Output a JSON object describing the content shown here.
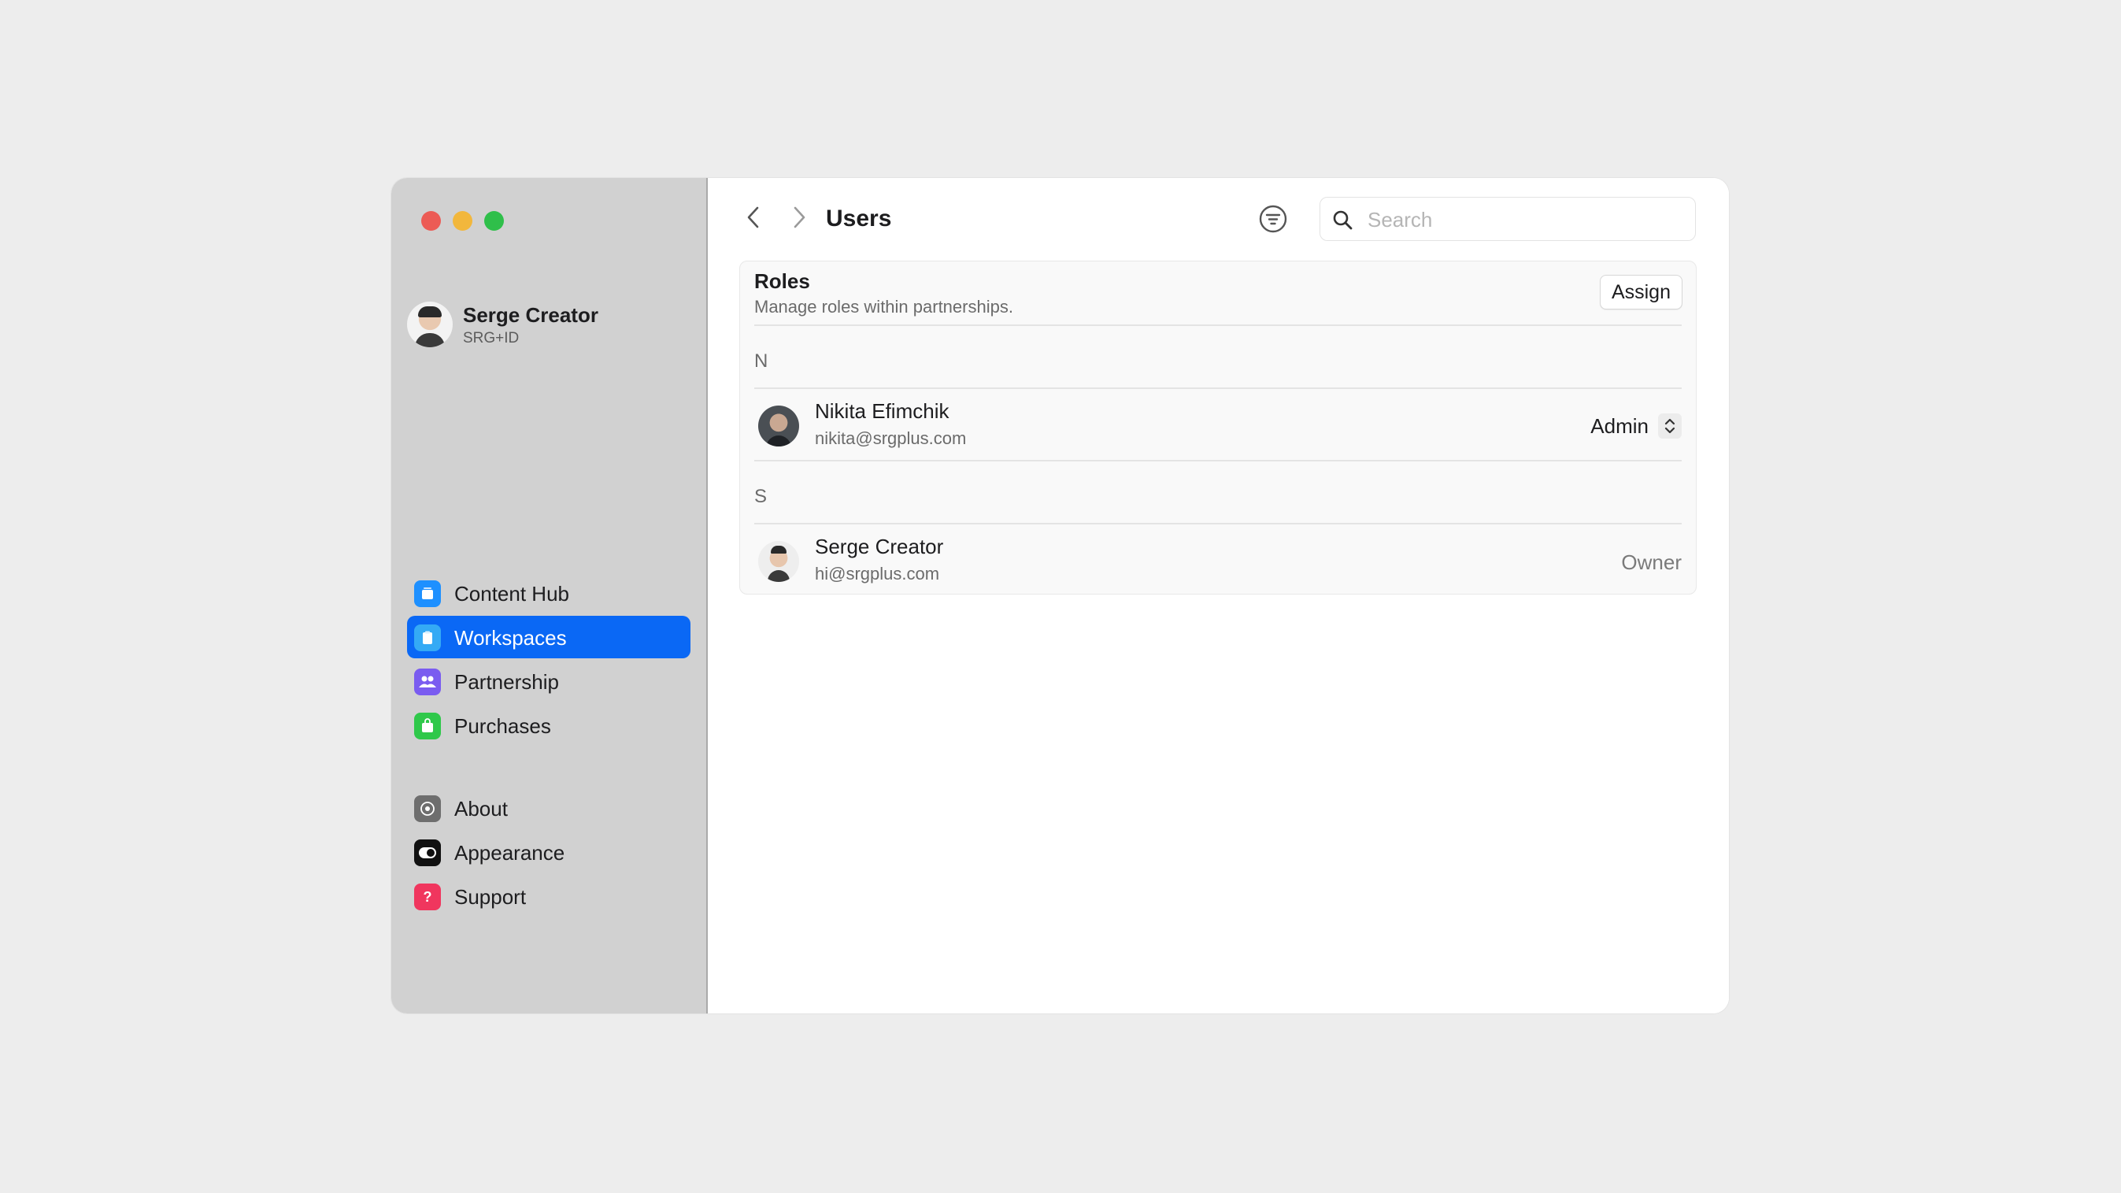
{
  "window": {
    "controls": [
      "close",
      "minimize",
      "zoom"
    ]
  },
  "sidebar": {
    "profile": {
      "name": "Serge Creator",
      "id": "SRG+ID"
    },
    "primary_items": [
      {
        "label": "Content Hub",
        "icon": "content-hub-icon",
        "color": "#1e90ff",
        "active": false
      },
      {
        "label": "Workspaces",
        "icon": "workspaces-icon",
        "color": "#34aaf5",
        "active": true
      },
      {
        "label": "Partnership",
        "icon": "partnership-icon",
        "color": "#7a5cf0",
        "active": false
      },
      {
        "label": "Purchases",
        "icon": "purchases-icon",
        "color": "#2fc84a",
        "active": false
      }
    ],
    "secondary_items": [
      {
        "label": "About",
        "icon": "about-icon",
        "color": "#6e6e6e"
      },
      {
        "label": "Appearance",
        "icon": "appearance-icon",
        "color": "#111111"
      },
      {
        "label": "Support",
        "icon": "support-icon",
        "color": "#f0365e"
      }
    ]
  },
  "main": {
    "title": "Users",
    "search": {
      "placeholder": "Search",
      "value": ""
    },
    "roles": {
      "title": "Roles",
      "subtitle": "Manage roles within partnerships.",
      "assign_label": "Assign"
    },
    "groups": [
      {
        "letter": "N",
        "users": [
          {
            "name": "Nikita Efimchik",
            "email": "nikita@srgplus.com",
            "role": "Admin",
            "editable": true
          }
        ]
      },
      {
        "letter": "S",
        "users": [
          {
            "name": "Serge Creator",
            "email": "hi@srgplus.com",
            "role": "Owner",
            "editable": false
          }
        ]
      }
    ]
  },
  "colors": {
    "accent": "#0a68f5",
    "sidebar_bg": "#d1d1d1",
    "close": "#ec5b55",
    "minimize": "#f2b73c",
    "zoom": "#2fbf4a"
  }
}
